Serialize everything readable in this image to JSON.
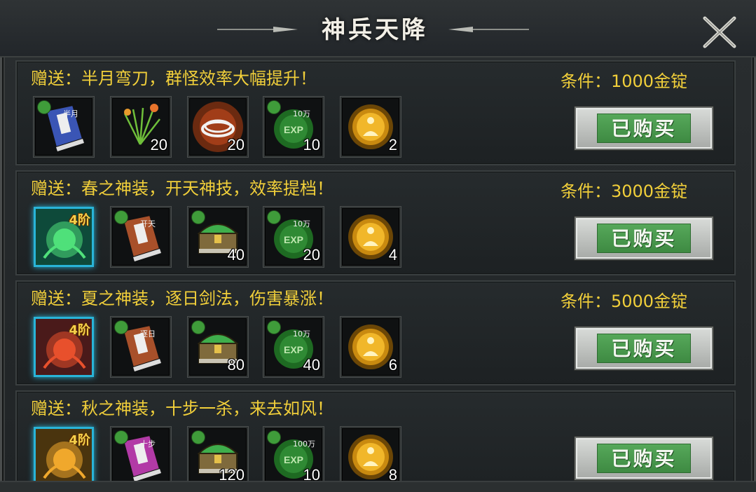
{
  "window": {
    "title": "神兵天降"
  },
  "button_label": "已购买",
  "rows": [
    {
      "text": "赠送：半月弯刀，群怪效率大幅提升！",
      "condition": "条件：1000金锭",
      "items": [
        {
          "icon": "skill-book-blue-icon",
          "label": "半月",
          "count": "",
          "dot": true
        },
        {
          "icon": "herb-bundle-icon",
          "count": "20",
          "dot": false
        },
        {
          "icon": "rope-coil-icon",
          "count": "20",
          "dot": false
        },
        {
          "icon": "exp-orb-icon",
          "label": "10万",
          "count": "10",
          "dot": true
        },
        {
          "icon": "golden-buddha-orb-icon",
          "count": "2",
          "dot": false
        }
      ]
    },
    {
      "text": "赠送：春之神装，开天神技，效率提档！",
      "condition": "条件：3000金锭",
      "items": [
        {
          "icon": "green-equipment-set-icon",
          "tier": "4阶",
          "count": "",
          "special": true
        },
        {
          "icon": "skill-book-brown-icon",
          "label": "开天",
          "count": "",
          "dot": true
        },
        {
          "icon": "treasure-chest-icon",
          "count": "40",
          "dot": true
        },
        {
          "icon": "exp-orb-icon",
          "label": "10万",
          "count": "20",
          "dot": true
        },
        {
          "icon": "golden-buddha-orb-icon",
          "count": "4",
          "dot": false
        }
      ]
    },
    {
      "text": "赠送：夏之神装，逐日剑法，伤害暴涨！",
      "condition": "条件：5000金锭",
      "items": [
        {
          "icon": "red-equipment-set-icon",
          "tier": "4阶",
          "count": "",
          "special": true
        },
        {
          "icon": "skill-book-brown-icon",
          "label": "逐日",
          "count": "",
          "dot": true
        },
        {
          "icon": "treasure-chest-icon",
          "count": "80",
          "dot": true
        },
        {
          "icon": "exp-orb-icon",
          "label": "10万",
          "count": "40",
          "dot": true
        },
        {
          "icon": "golden-buddha-orb-icon",
          "count": "6",
          "dot": false
        }
      ]
    },
    {
      "text": "赠送：秋之神装，十步一杀，来去如风！",
      "condition": "",
      "items": [
        {
          "icon": "gold-equipment-set-icon",
          "tier": "4阶",
          "count": "",
          "special": true
        },
        {
          "icon": "skill-book-purple-icon",
          "label": "十步",
          "count": "",
          "dot": true
        },
        {
          "icon": "treasure-chest-icon",
          "count": "120",
          "dot": true
        },
        {
          "icon": "exp-orb-icon",
          "label": "100万",
          "count": "10",
          "dot": true
        },
        {
          "icon": "golden-buddha-orb-icon",
          "count": "8",
          "dot": false
        }
      ]
    }
  ],
  "colors": {
    "accent_text": "#f1cf3a",
    "button_green": "#4c9c50",
    "special_border": "#29b4d8"
  }
}
